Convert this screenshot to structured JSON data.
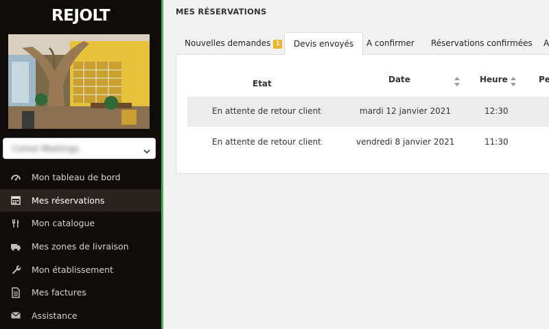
{
  "brand": {
    "name": "REJOLT",
    "accent": "#4caf50",
    "badge_color": "#f0b323"
  },
  "sidebar": {
    "select_value": "Comet Meetings",
    "items": [
      {
        "label": "Mon tableau de bord",
        "icon": "dashboard-icon"
      },
      {
        "label": "Mes réservations",
        "icon": "calendar-icon",
        "active": true
      },
      {
        "label": "Mon catalogue",
        "icon": "utensils-icon"
      },
      {
        "label": "Mes zones de livraison",
        "icon": "truck-icon"
      },
      {
        "label": "Mon établissement",
        "icon": "wrench-icon"
      },
      {
        "label": "Mes factures",
        "icon": "document-icon"
      },
      {
        "label": "Assistance",
        "icon": "envelope-icon"
      }
    ]
  },
  "main": {
    "title": "MES RÉSERVATIONS",
    "tabs": [
      {
        "label": "Nouvelles demandes",
        "badge": "1"
      },
      {
        "label": "Devis envoyés",
        "active": true
      },
      {
        "label": "A confirmer"
      },
      {
        "label": "Réservations confirmées"
      },
      {
        "label": "A"
      }
    ],
    "table": {
      "headers": [
        "Etat",
        "Date",
        "Heure",
        "Per"
      ],
      "rows": [
        {
          "etat": "En attente de retour client",
          "date": "mardi 12 janvier 2021",
          "heure": "12:30"
        },
        {
          "etat": "En attente de retour client",
          "date": "vendredi 8 janvier 2021",
          "heure": "11:30"
        }
      ]
    }
  }
}
